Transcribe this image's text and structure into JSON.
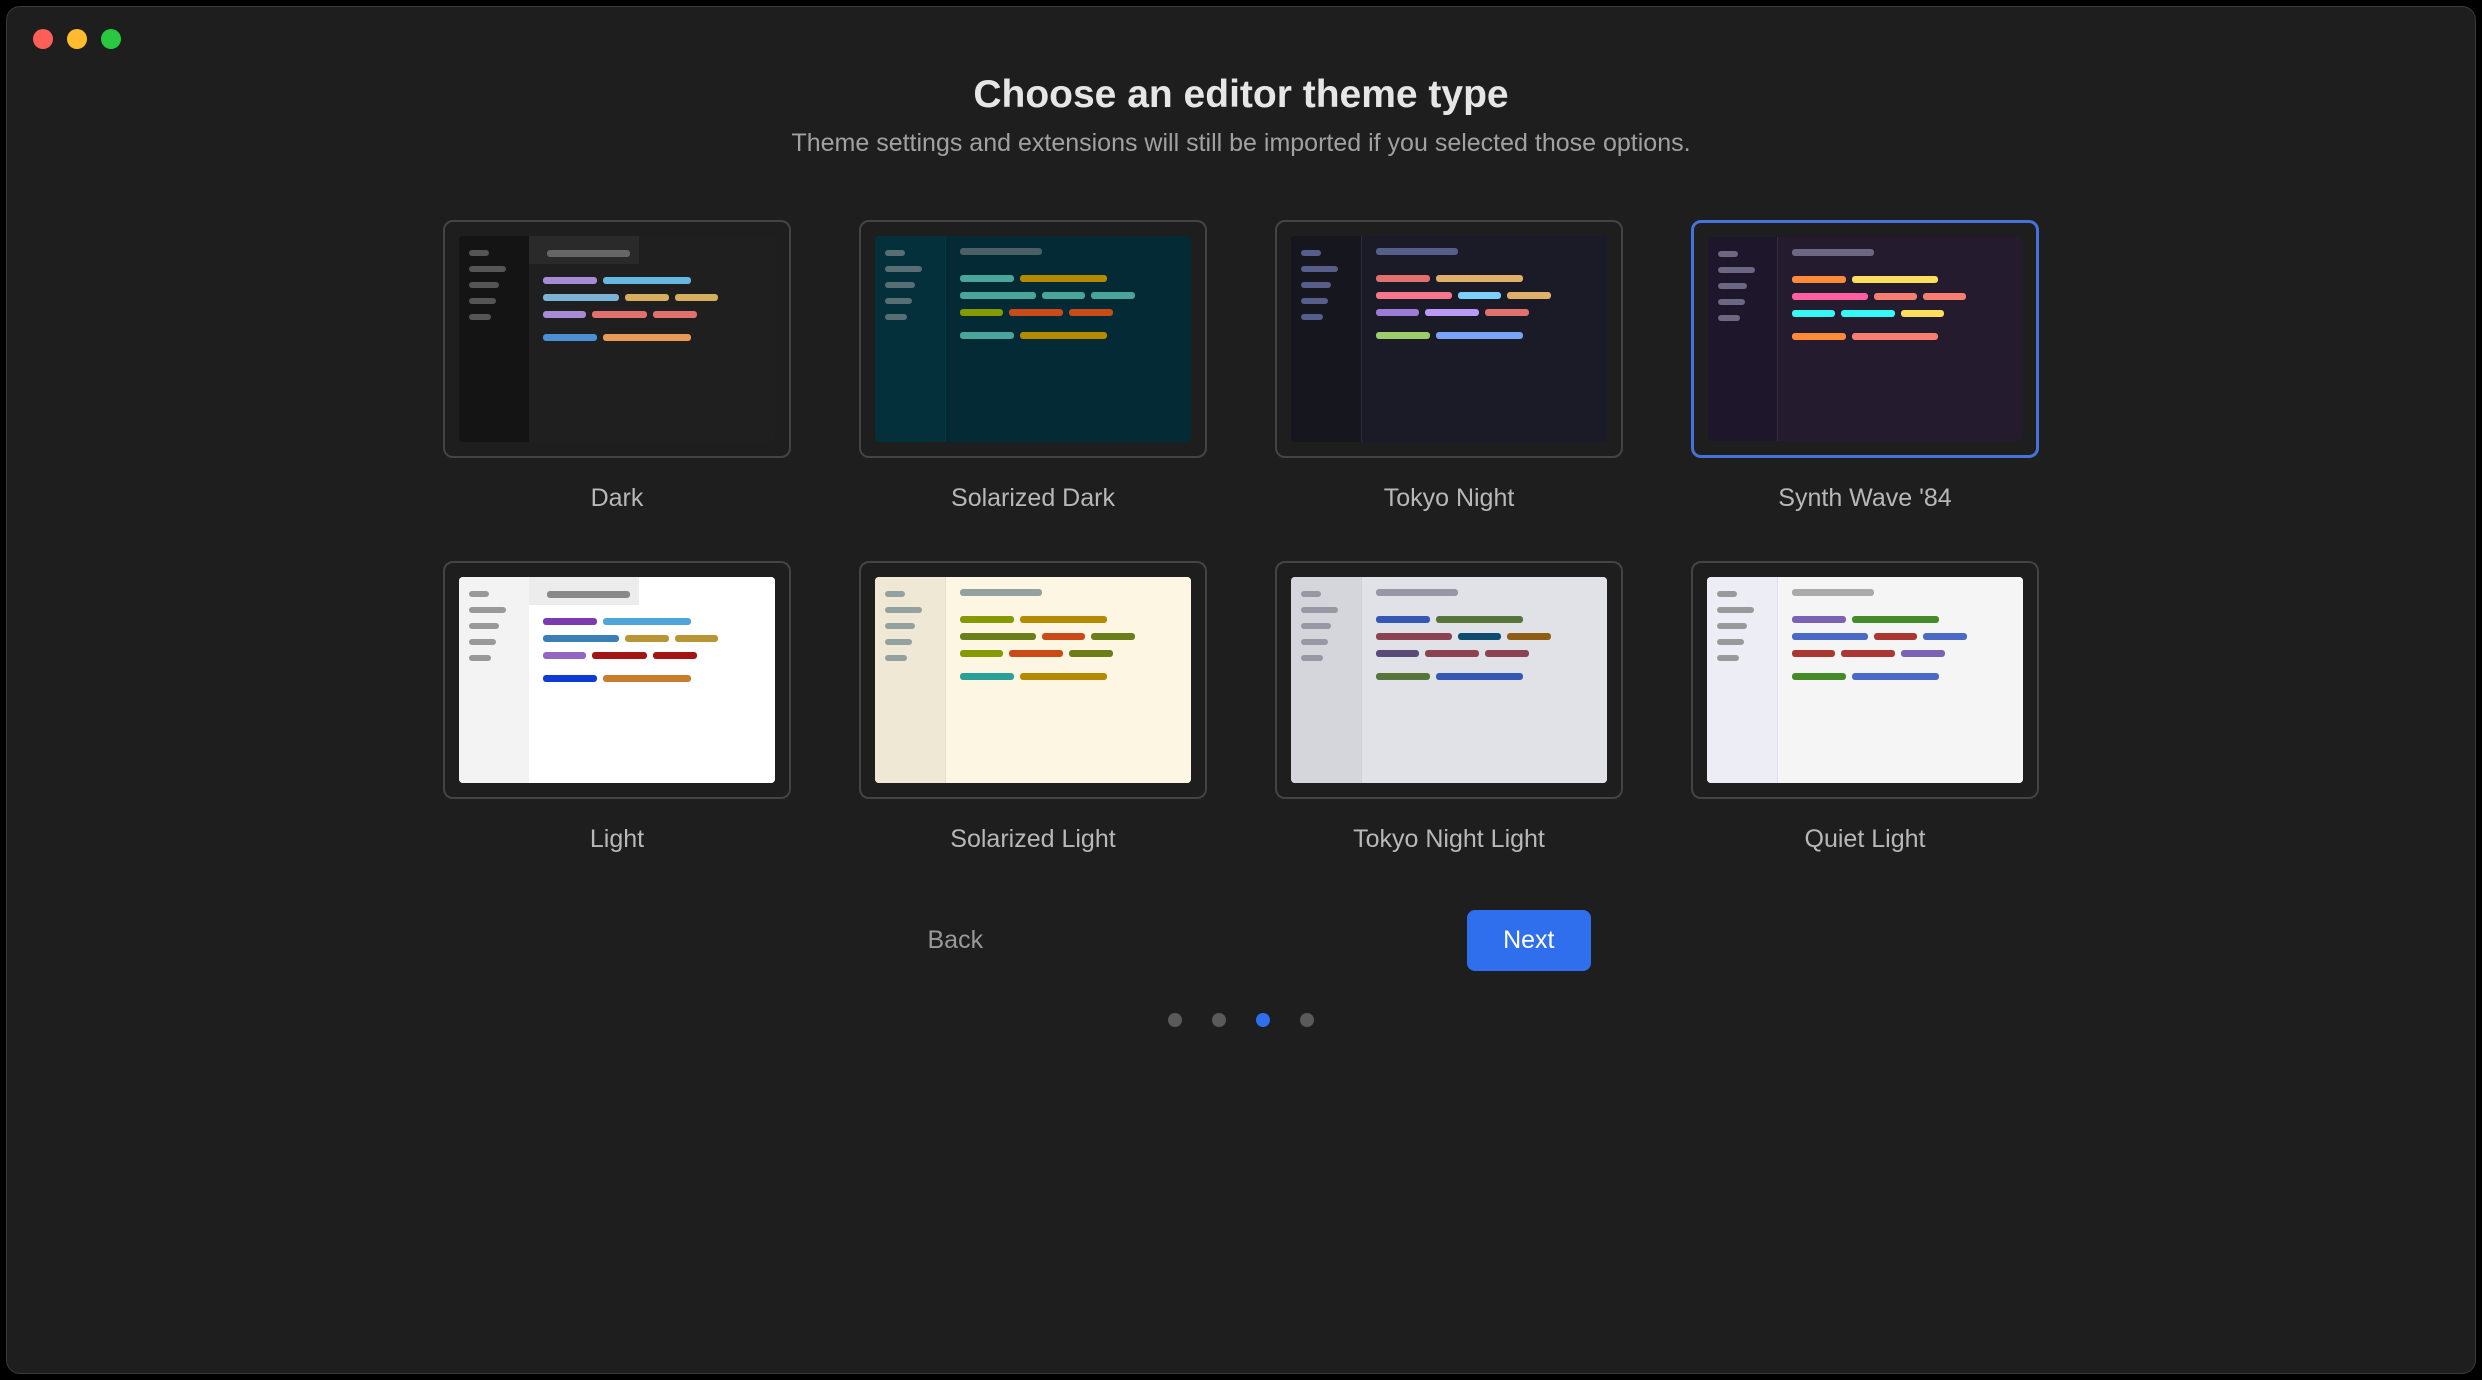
{
  "header": {
    "title": "Choose an editor theme type",
    "subtitle": "Theme settings and extensions will still be imported if you selected those options."
  },
  "themes": [
    {
      "id": "dark",
      "label": "Dark",
      "selected": false
    },
    {
      "id": "solarized-dark",
      "label": "Solarized Dark",
      "selected": false
    },
    {
      "id": "tokyo-night",
      "label": "Tokyo Night",
      "selected": false
    },
    {
      "id": "synth-wave-84",
      "label": "Synth Wave '84",
      "selected": true
    },
    {
      "id": "light",
      "label": "Light",
      "selected": false
    },
    {
      "id": "solarized-light",
      "label": "Solarized Light",
      "selected": false
    },
    {
      "id": "tokyo-night-light",
      "label": "Tokyo Night Light",
      "selected": false
    },
    {
      "id": "quiet-light",
      "label": "Quiet Light",
      "selected": false
    }
  ],
  "nav": {
    "back": "Back",
    "next": "Next"
  },
  "steps": {
    "total": 4,
    "current": 3
  }
}
